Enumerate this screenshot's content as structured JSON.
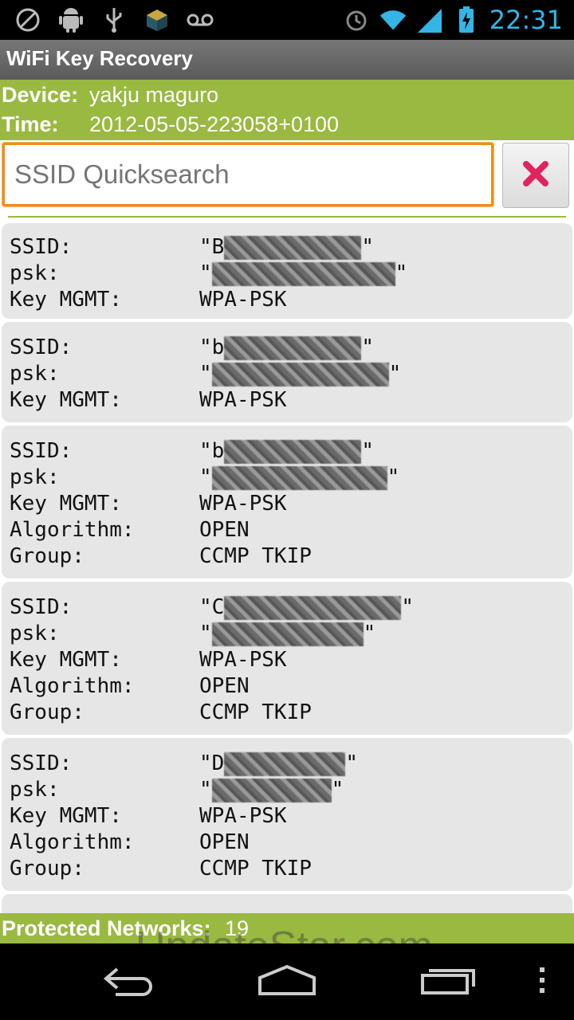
{
  "status_bar": {
    "left_icons": [
      "no-sim-icon",
      "android-debug-icon",
      "usb-icon",
      "app-notification-icon",
      "voicemail-icon"
    ],
    "right_icons": [
      "alarm-icon",
      "wifi-icon",
      "signal-icon",
      "battery-charging-icon"
    ],
    "time": "22:31",
    "accent_color": "#33b5e5"
  },
  "app": {
    "title": "WiFi Key Recovery"
  },
  "info": {
    "device_label": "Device:",
    "device_value": "yakju maguro",
    "time_label": "Time:",
    "time_value": "2012-05-05-223058+0100",
    "bar_color": "#99b940"
  },
  "search": {
    "placeholder": "SSID Quicksearch",
    "clear_icon": "close-icon"
  },
  "networks": [
    {
      "ssid_label": "SSID:",
      "ssid_value": "\"B",
      "psk_label": "psk:",
      "psk_value": "\"",
      "keymgmt_label": "Key MGMT:",
      "keymgmt_value": "WPA-PSK"
    },
    {
      "ssid_label": "SSID:",
      "ssid_value": "\"b",
      "psk_label": "psk:",
      "psk_value": "\"",
      "keymgmt_label": "Key MGMT:",
      "keymgmt_value": "WPA-PSK"
    },
    {
      "ssid_label": "SSID:",
      "ssid_value": "\"b",
      "psk_label": "psk:",
      "psk_value": "\"",
      "keymgmt_label": "Key MGMT:",
      "keymgmt_value": "WPA-PSK",
      "algorithm_label": "Algorithm:",
      "algorithm_value": "OPEN",
      "group_label": "Group:",
      "group_value": "CCMP TKIP"
    },
    {
      "ssid_label": "SSID:",
      "ssid_value": "\"C",
      "psk_label": "psk:",
      "psk_value": "\"",
      "keymgmt_label": "Key MGMT:",
      "keymgmt_value": "WPA-PSK",
      "algorithm_label": "Algorithm:",
      "algorithm_value": "OPEN",
      "group_label": "Group:",
      "group_value": "CCMP TKIP"
    },
    {
      "ssid_label": "SSID:",
      "ssid_value": "\"D",
      "psk_label": "psk:",
      "psk_value": "\"",
      "keymgmt_label": "Key MGMT:",
      "keymgmt_value": "WPA-PSK",
      "algorithm_label": "Algorithm:",
      "algorithm_value": "OPEN",
      "group_label": "Group:",
      "group_value": "CCMP TKIP"
    }
  ],
  "footer": {
    "label": "Protected Networks:",
    "value": "19"
  },
  "watermark": "UpdateStar.com",
  "nav_bar": {
    "icons": [
      "back-icon",
      "home-icon",
      "recent-apps-icon",
      "menu-icon"
    ]
  }
}
